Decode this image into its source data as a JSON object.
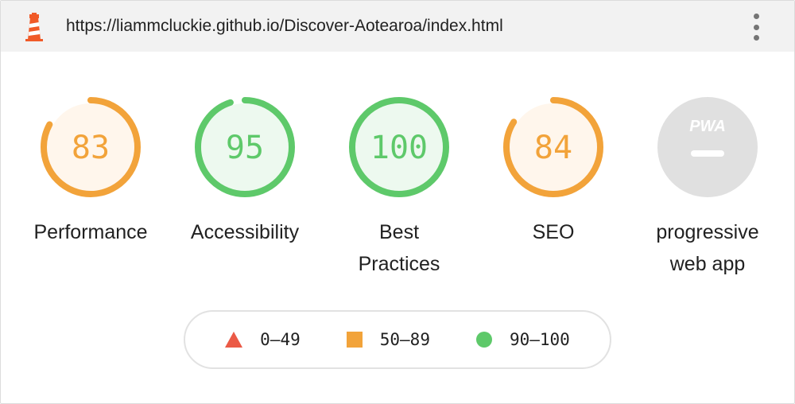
{
  "header": {
    "url": "https://liammcluckie.github.io/Discover-Aotearoa/index.html",
    "logo_icon": "lighthouse-icon",
    "menu_icon": "more-vertical-icon"
  },
  "gauges": [
    {
      "score": "83",
      "value": 83,
      "label": "Performance",
      "rating": "average",
      "color": "#f2a33a",
      "fill": "#fff6ec"
    },
    {
      "score": "95",
      "value": 95,
      "label": "Accessibility",
      "rating": "pass",
      "color": "#5ec96a",
      "fill": "#edf9ef"
    },
    {
      "score": "100",
      "value": 100,
      "label": "Best Practices",
      "label_lines": [
        "Best",
        "Practices"
      ],
      "rating": "pass",
      "color": "#5ec96a",
      "fill": "#edf9ef"
    },
    {
      "score": "84",
      "value": 84,
      "label": "SEO",
      "rating": "average",
      "color": "#f2a33a",
      "fill": "#fff6ec"
    },
    {
      "score": "",
      "badge": "PWA",
      "label": "progressive web app",
      "label_lines": [
        "progressive",
        "web app"
      ],
      "rating": "na",
      "color": "#e0e0e0",
      "fill": "#e0e0e0"
    }
  ],
  "legend": [
    {
      "range": "0–49",
      "icon": "triangle-icon",
      "color": "#eb5a46"
    },
    {
      "range": "50–89",
      "icon": "square-icon",
      "color": "#f2a33a"
    },
    {
      "range": "90–100",
      "icon": "circle-icon",
      "color": "#5ec96a"
    }
  ]
}
